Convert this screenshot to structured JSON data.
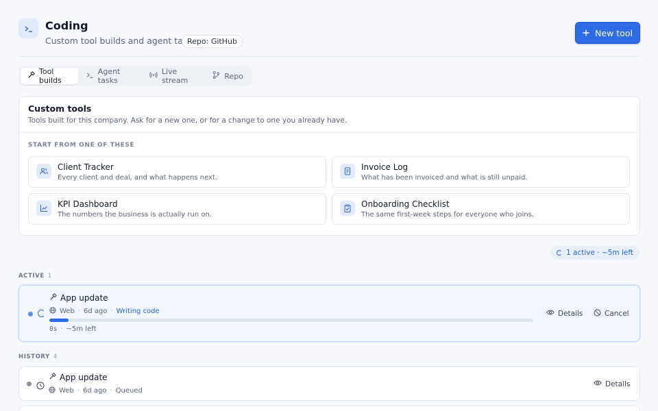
{
  "header": {
    "icon": "terminal-prompt-icon",
    "title": "Coding",
    "subtitle": "Custom tool builds and agent tasks",
    "repo_badge": "Repo: GitHub",
    "new_tool_label": "New tool"
  },
  "tabs": [
    {
      "label": "Tool builds",
      "icon": "hammer-icon",
      "active": true
    },
    {
      "label": "Agent tasks",
      "icon": "terminal-icon",
      "active": false
    },
    {
      "label": "Live stream",
      "icon": "broadcast-icon",
      "active": false
    },
    {
      "label": "Repo",
      "icon": "git-branch-icon",
      "active": false
    }
  ],
  "custom_tools": {
    "title": "Custom tools",
    "description": "Tools built for this company. Ask for a new one, or for a change to one you already have.",
    "start_label": "START FROM ONE OF THESE",
    "templates": [
      {
        "name": "Client Tracker",
        "description": "Every client and deal, and what happens next.",
        "icon": "users-icon"
      },
      {
        "name": "Invoice Log",
        "description": "What has been invoiced and what is still unpaid.",
        "icon": "receipt-icon"
      },
      {
        "name": "KPI Dashboard",
        "description": "The numbers the business is actually run on.",
        "icon": "line-chart-icon"
      },
      {
        "name": "Onboarding Checklist",
        "description": "The same first-week steps for everyone who joins.",
        "icon": "clipboard-check-icon"
      }
    ]
  },
  "status_pill": "1 active · ~5m left",
  "active_section": {
    "label": "ACTIVE",
    "count": "1"
  },
  "active_job": {
    "title": "App update",
    "platform": "Web",
    "age": "6d ago",
    "stage": "Writing code",
    "progress": 0.04,
    "elapsed": "0s",
    "remaining": "~5m left",
    "details_label": "Details",
    "cancel_label": "Cancel"
  },
  "history_section": {
    "label": "HISTORY",
    "count": "4"
  },
  "history_jobs": [
    {
      "title": "App update",
      "platform": "Web",
      "age": "6d ago",
      "status": "Queued",
      "details_label": "Details"
    }
  ],
  "sep": "·",
  "colors": {
    "accent": "#2e6be6",
    "active_bg": "#f2f6fd",
    "muted_dot": "#8a919c"
  }
}
